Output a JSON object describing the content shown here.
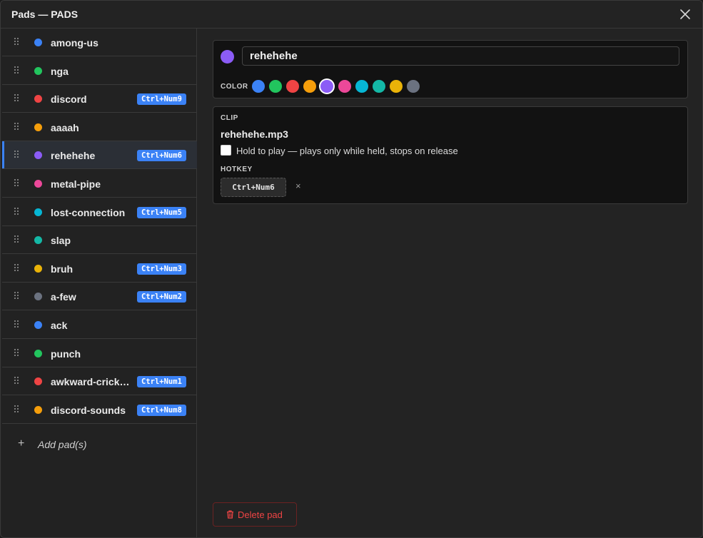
{
  "window": {
    "title": "Pads — PADS"
  },
  "pads": [
    {
      "name": "among-us",
      "color": "#3b82f6",
      "hotkey": ""
    },
    {
      "name": "nga",
      "color": "#22c55e",
      "hotkey": ""
    },
    {
      "name": "discord",
      "color": "#ef4444",
      "hotkey": "Ctrl+Num9"
    },
    {
      "name": "aaaah",
      "color": "#f59e0b",
      "hotkey": ""
    },
    {
      "name": "rehehehe",
      "color": "#8b5cf6",
      "hotkey": "Ctrl+Num6",
      "selected": true
    },
    {
      "name": "metal-pipe",
      "color": "#ec4899",
      "hotkey": ""
    },
    {
      "name": "lost-connection",
      "color": "#06b6d4",
      "hotkey": "Ctrl+Num5"
    },
    {
      "name": "slap",
      "color": "#14b8a6",
      "hotkey": ""
    },
    {
      "name": "bruh",
      "color": "#eab308",
      "hotkey": "Ctrl+Num3"
    },
    {
      "name": "a-few",
      "color": "#6b7280",
      "hotkey": "Ctrl+Num2"
    },
    {
      "name": "ack",
      "color": "#3b82f6",
      "hotkey": ""
    },
    {
      "name": "punch",
      "color": "#22c55e",
      "hotkey": ""
    },
    {
      "name": "awkward-cricke...",
      "color": "#ef4444",
      "hotkey": "Ctrl+Num1"
    },
    {
      "name": "discord-sounds",
      "color": "#f59e0b",
      "hotkey": "Ctrl+Num8"
    }
  ],
  "sidebar": {
    "add_label": "Add pad(s)",
    "add_icon": "+"
  },
  "editor": {
    "name_value": "rehehehe",
    "color_label": "COLOR",
    "selected_color": "#8b5cf6",
    "swatches": [
      "#3b82f6",
      "#22c55e",
      "#ef4444",
      "#f59e0b",
      "#8b5cf6",
      "#ec4899",
      "#06b6d4",
      "#14b8a6",
      "#eab308",
      "#6b7280"
    ],
    "clip_label": "CLIP",
    "clip_file": "rehehehe.mp3",
    "hold_label": "Hold to play — plays only while held, stops on release",
    "hold_checked": false,
    "hotkey_label": "HOTKEY",
    "hotkey_value": "Ctrl+Num6",
    "hotkey_clear": "×",
    "delete_label": "Delete pad"
  }
}
